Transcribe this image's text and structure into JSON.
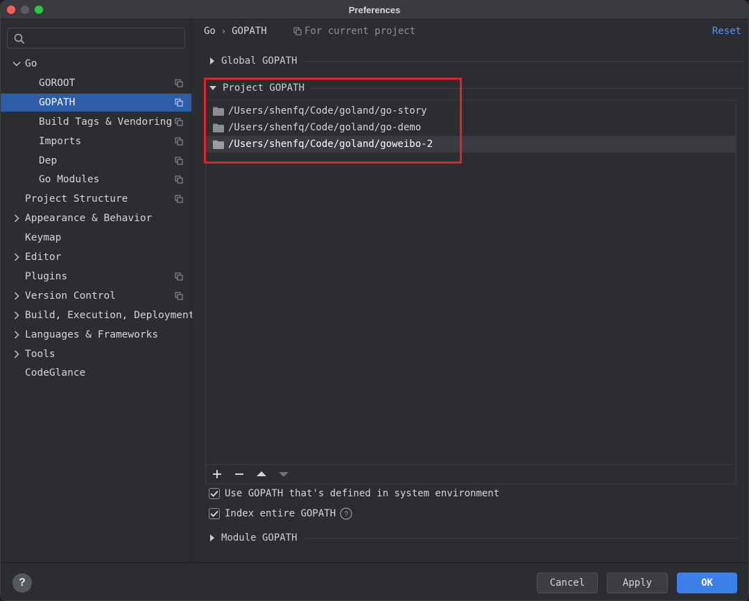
{
  "window": {
    "title": "Preferences"
  },
  "search": {
    "placeholder": ""
  },
  "sidebar": {
    "items": [
      {
        "label": "Go",
        "expanded": true,
        "has_arrow": true,
        "copy_icon": false
      },
      {
        "label": "GOROOT",
        "copy_icon": true
      },
      {
        "label": "GOPATH",
        "copy_icon": true,
        "selected": true
      },
      {
        "label": "Build Tags & Vendoring",
        "copy_icon": true
      },
      {
        "label": "Imports",
        "copy_icon": true
      },
      {
        "label": "Dep",
        "copy_icon": true
      },
      {
        "label": "Go Modules",
        "copy_icon": true
      },
      {
        "label": "Project Structure",
        "copy_icon": true
      },
      {
        "label": "Appearance & Behavior",
        "has_arrow": true
      },
      {
        "label": "Keymap"
      },
      {
        "label": "Editor",
        "has_arrow": true
      },
      {
        "label": "Plugins",
        "copy_icon": true
      },
      {
        "label": "Version Control",
        "has_arrow": true,
        "copy_icon": true
      },
      {
        "label": "Build, Execution, Deployment",
        "has_arrow": true
      },
      {
        "label": "Languages & Frameworks",
        "has_arrow": true
      },
      {
        "label": "Tools",
        "has_arrow": true
      },
      {
        "label": "CodeGlance"
      }
    ]
  },
  "header": {
    "breadcrumb": [
      "Go",
      "GOPATH"
    ],
    "scope_label": "For current project",
    "reset_label": "Reset"
  },
  "sections": {
    "global_gopath": "Global GOPATH",
    "project_gopath": "Project GOPATH",
    "module_gopath": "Module GOPATH"
  },
  "project_paths": [
    "/Users/shenfq/Code/goland/go-story",
    "/Users/shenfq/Code/goland/go-demo",
    "/Users/shenfq/Code/goland/goweibo-2"
  ],
  "options": {
    "use_system_gopath": {
      "label": "Use GOPATH that's defined in system environment",
      "checked": true
    },
    "index_entire_gopath": {
      "label": "Index entire GOPATH",
      "checked": true
    }
  },
  "footer": {
    "help_label": "?",
    "cancel_label": "Cancel",
    "apply_label": "Apply",
    "ok_label": "OK"
  },
  "colors": {
    "selection": "#2e5da8",
    "accent": "#3d7fe8",
    "highlight_box": "#e0242b",
    "link": "#5a96f5"
  }
}
